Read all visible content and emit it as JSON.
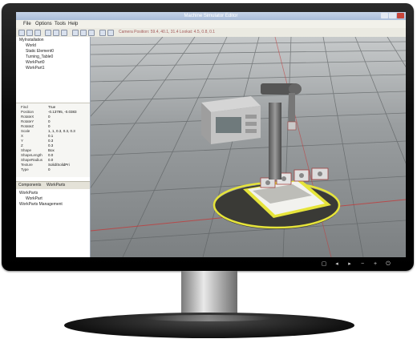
{
  "window": {
    "title": "Machine Simulator Editor"
  },
  "menu": [
    "File",
    "Options",
    "Tools",
    "Help"
  ],
  "toolbar": {
    "info": "Camera Position: 59.4, 40.1, 31.4   Lookat: 4.5, 0.8, 0.1"
  },
  "scene_tree": {
    "root": "MyInstallation",
    "items": [
      "World",
      "Static Element0",
      "Turning_Table0",
      "WorkPart0",
      "WorkPart1"
    ]
  },
  "properties": [
    {
      "key": "Find",
      "value": "True"
    },
    {
      "key": "Position",
      "value": "-0.13795, -0.0383"
    },
    {
      "key": "RotateX",
      "value": "0"
    },
    {
      "key": "RotateY",
      "value": "0"
    },
    {
      "key": "RotateZ",
      "value": "0"
    },
    {
      "key": "Scale",
      "value": "1, 1, 0.3, 0.3, 0.3"
    },
    {
      "key": "X",
      "value": "0.1"
    },
    {
      "key": "Y",
      "value": "0.3"
    },
    {
      "key": "Z",
      "value": "0.3"
    },
    {
      "key": "Shape",
      "value": "Box"
    },
    {
      "key": "ShapeLength",
      "value": "0.0"
    },
    {
      "key": "ShapeRadius",
      "value": "0.0"
    },
    {
      "key": "Texture",
      "value": "Solid/SolidPri"
    },
    {
      "key": "Type",
      "value": "0"
    }
  ],
  "components_panel": {
    "tabs": [
      "Components",
      "WorkParts"
    ],
    "items": [
      "WorkParts",
      "WorkPart",
      "WorkParts Management"
    ]
  },
  "monitor_controls": [
    "menu-button",
    "left-arrow",
    "right-arrow",
    "minus",
    "plus",
    "power"
  ],
  "colors": {
    "bezel": "#0b0b0b",
    "floor": "#8c9092",
    "accent_yellow": "#e6e43a"
  }
}
